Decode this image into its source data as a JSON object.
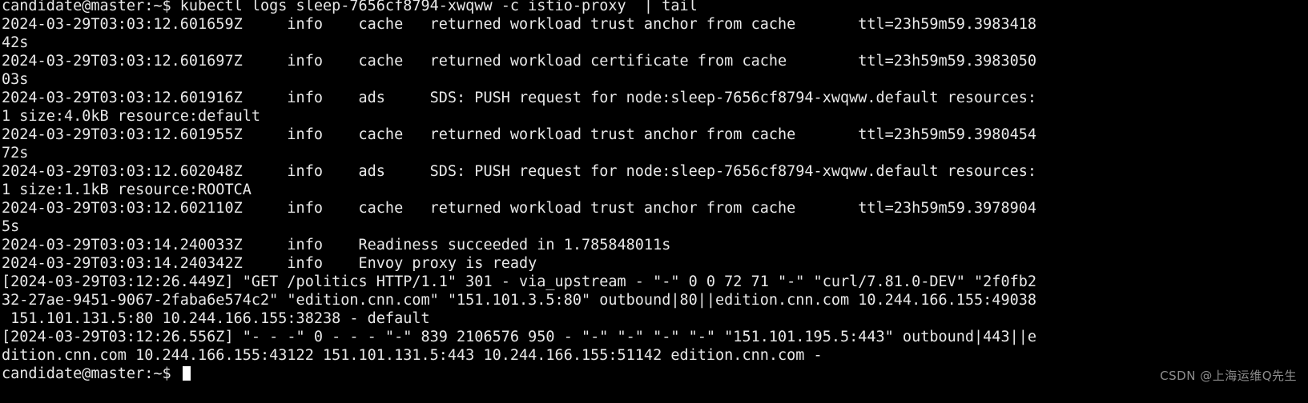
{
  "terminal": {
    "title": "candidate@master terminal",
    "background_color": "#000000",
    "foreground_color": "#e8e8e8",
    "watermark": "CSDN @上海运维Q先生",
    "watermark_color": "#8d8d8d",
    "prompt": "candidate@master:~$",
    "command": "kubectl logs sleep-7656cf8794-xwqww -c istio-proxy  | tail",
    "cursor_visible": true,
    "rows": [
      "candidate@master:~$ kubectl logs sleep-7656cf8794-xwqww -c istio-proxy  | tail",
      "2024-03-29T03:03:12.601659Z     info    cache   returned workload trust anchor from cache       ttl=23h59m59.3983418",
      "42s",
      "2024-03-29T03:03:12.601697Z     info    cache   returned workload certificate from cache        ttl=23h59m59.3983050",
      "03s",
      "2024-03-29T03:03:12.601916Z     info    ads     SDS: PUSH request for node:sleep-7656cf8794-xwqww.default resources:",
      "1 size:4.0kB resource:default",
      "2024-03-29T03:03:12.601955Z     info    cache   returned workload trust anchor from cache       ttl=23h59m59.3980454",
      "72s",
      "2024-03-29T03:03:12.602048Z     info    ads     SDS: PUSH request for node:sleep-7656cf8794-xwqww.default resources:",
      "1 size:1.1kB resource:ROOTCA",
      "2024-03-29T03:03:12.602110Z     info    cache   returned workload trust anchor from cache       ttl=23h59m59.3978904",
      "5s",
      "2024-03-29T03:03:14.240033Z     info    Readiness succeeded in 1.785848011s",
      "2024-03-29T03:03:14.240342Z     info    Envoy proxy is ready",
      "[2024-03-29T03:12:26.449Z] \"GET /politics HTTP/1.1\" 301 - via_upstream - \"-\" 0 0 72 71 \"-\" \"curl/7.81.0-DEV\" \"2f0fb2",
      "32-27ae-9451-9067-2faba6e574c2\" \"edition.cnn.com\" \"151.101.3.5:80\" outbound|80||edition.cnn.com 10.244.166.155:49038",
      " 151.101.131.5:80 10.244.166.155:38238 - default",
      "[2024-03-29T03:12:26.556Z] \"- - -\" 0 - - - \"-\" 839 2106576 950 - \"-\" \"-\" \"-\" \"-\" \"151.101.195.5:443\" outbound|443||e",
      "dition.cnn.com 10.244.166.155:43122 151.101.131.5:443 10.244.166.155:51142 edition.cnn.com -",
      "candidate@master:~$ "
    ]
  }
}
